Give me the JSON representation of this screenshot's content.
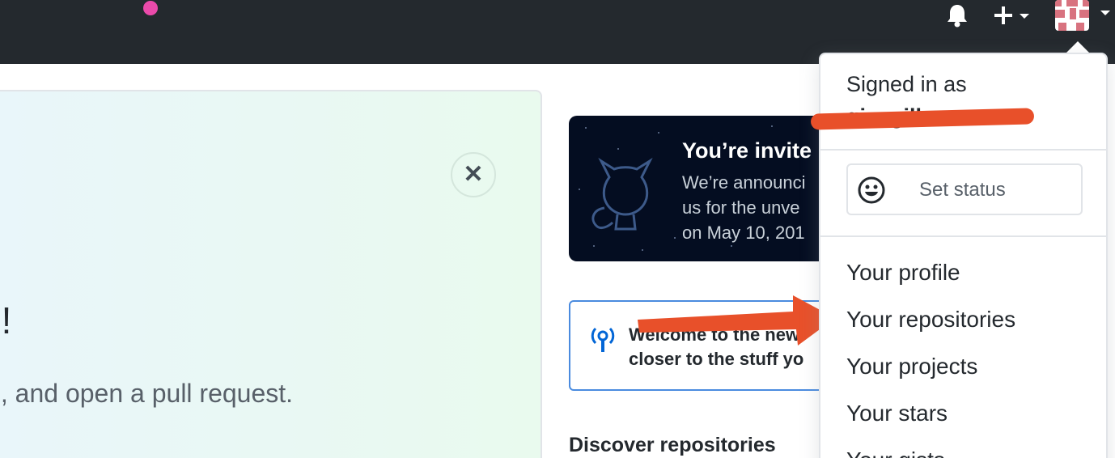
{
  "header": {
    "icons": [
      "bell-icon",
      "plus-icon",
      "avatar"
    ]
  },
  "hero": {
    "title_partial": "e!",
    "subtitle_partial": "ts, and open a pull request.",
    "close_glyph": "✕"
  },
  "invite_card": {
    "title": "You’re invite",
    "lines": [
      "We’re announci",
      "us for the unve",
      "on May 10, 201"
    ]
  },
  "welcome_card": {
    "lines": [
      "Welcome to the new",
      "closer to the stuff yo"
    ]
  },
  "discover_heading": "Discover repositories",
  "user_menu": {
    "signed_in_label": "Signed in as",
    "username_redacted": "gi... gill...ee",
    "set_status": "Set status",
    "items": [
      "Your profile",
      "Your repositories",
      "Your projects",
      "Your stars",
      "Your gists"
    ]
  },
  "colors": {
    "header_bg": "#24292e",
    "annotation": "#e8502a",
    "notification_dot": "#ea4aaa",
    "link_border": "#4a8bdf"
  }
}
